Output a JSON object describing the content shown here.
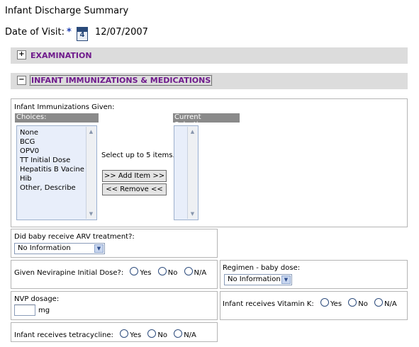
{
  "page": {
    "title": "Infant Discharge Summary",
    "visit_label": "Date of Visit:",
    "required_marker": "*",
    "calendar_day": "4",
    "visit_date": "12/07/2007"
  },
  "sections": {
    "examination": {
      "toggle": "+",
      "label": "EXAMINATION"
    },
    "immunizations": {
      "toggle": "−",
      "label": "INFANT IMMUNIZATIONS & MEDICATIONS"
    }
  },
  "immunizations": {
    "title": "Infant Immunizations Given:",
    "choices_header": "Choices:",
    "current_header": "Current Selections:",
    "choices": [
      "None",
      "BCG",
      "OPV0",
      "TT Initial Dose",
      "Hepatitis B Vacine",
      "Hib",
      "Other, Describe"
    ],
    "hint": "Select up to 5 items.",
    "add_button": ">> Add Item >>",
    "remove_button": "<< Remove <<"
  },
  "arv": {
    "question": "Did baby receive ARV treatment?:",
    "selected": "No Information"
  },
  "nevirapine": {
    "question": "Given Nevirapine Initial Dose?:",
    "options": [
      "Yes",
      "No",
      "N/A"
    ]
  },
  "regimen": {
    "question": "Regimen - baby dose:",
    "selected": "No Information"
  },
  "nvp": {
    "question": "NVP dosage:",
    "unit": "mg"
  },
  "vitamin_k": {
    "question": "Infant receives Vitamin K:",
    "options": [
      "Yes",
      "No",
      "N/A"
    ]
  },
  "tetracycline": {
    "question": "Infant receives tetracycline:",
    "options": [
      "Yes",
      "No",
      "N/A"
    ]
  },
  "icons": {
    "calendar": "calendar-icon",
    "expand": "plus-box-icon",
    "collapse": "minus-box-icon",
    "dropdown": "chevron-down-icon"
  },
  "colors": {
    "section_label": "#6f1a8c",
    "section_bar": "#dcdcdc",
    "listbox_bg": "#e8eefa",
    "required": "#1f3fb0"
  }
}
